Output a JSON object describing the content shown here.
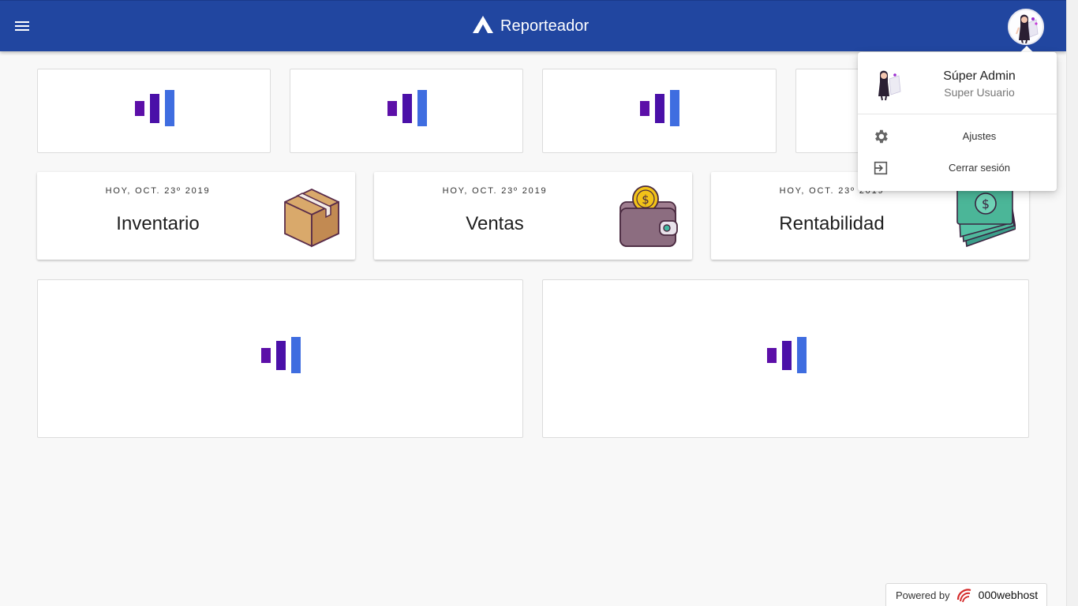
{
  "header": {
    "title": "Reporteador",
    "menu_icon": "hamburger-menu-icon",
    "logo_icon": "brand-logo-icon",
    "avatar_icon": "user-avatar-icon",
    "background_color": "#2146a0"
  },
  "loaders": {
    "colors": [
      "#5c0fa8",
      "#4a10a8",
      "#3f6de0"
    ]
  },
  "stats": [
    {
      "date": "HOY, OCT. 23º 2019",
      "title": "Inventario",
      "icon": "box-icon"
    },
    {
      "date": "HOY, OCT. 23º 2019",
      "title": "Ventas",
      "icon": "wallet-coin-icon"
    },
    {
      "date": "HOY, OCT. 23º 2019",
      "title": "Rentabilidad",
      "icon": "money-stack-icon"
    }
  ],
  "user_menu": {
    "name": "Súper Admin",
    "role": "Super Usuario",
    "items": [
      {
        "label": "Ajustes",
        "icon": "gear-icon"
      },
      {
        "label": "Cerrar sesión",
        "icon": "logout-icon"
      }
    ]
  },
  "footer": {
    "powered_by": "Powered by",
    "host_name": "000webhost"
  }
}
